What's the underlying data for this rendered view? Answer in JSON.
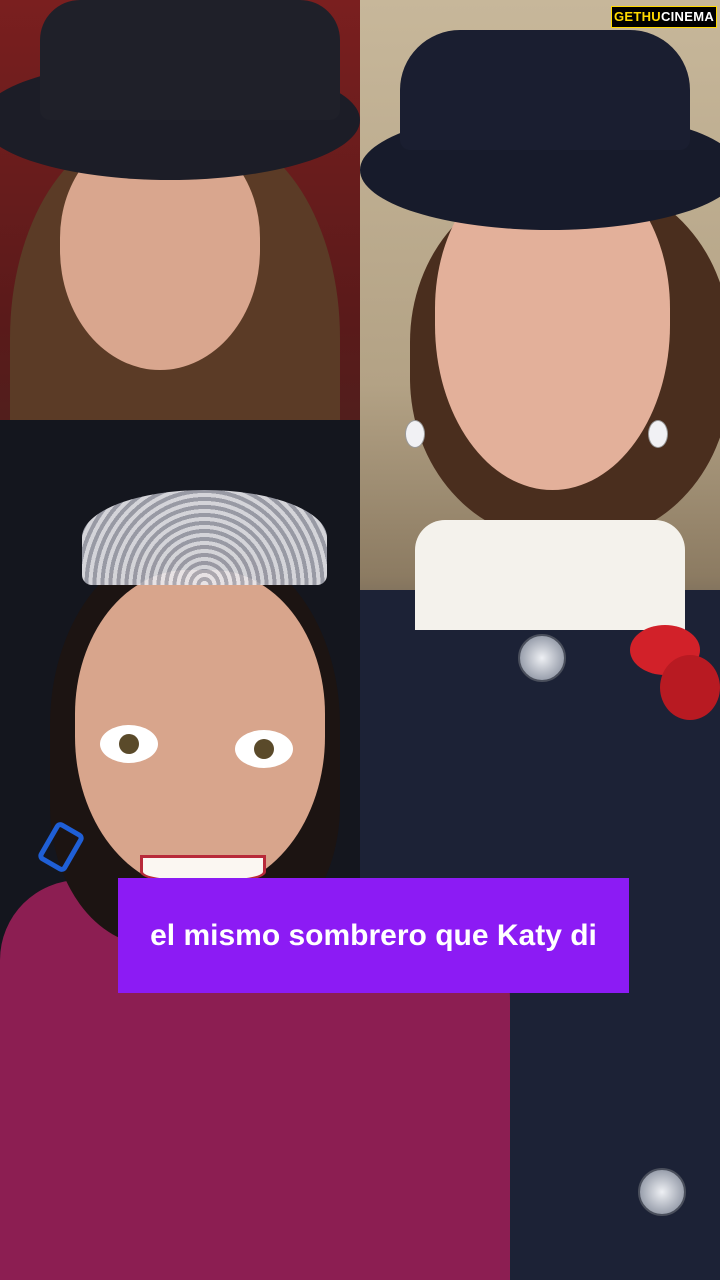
{
  "watermark": {
    "part1": "GETHU",
    "part2": "CINEMA"
  },
  "caption": {
    "text": "el mismo sombrero que Katy di"
  },
  "colors": {
    "caption_background": "#8c1bf4",
    "caption_text": "#ffffff",
    "watermark_accent": "#ffd900"
  }
}
